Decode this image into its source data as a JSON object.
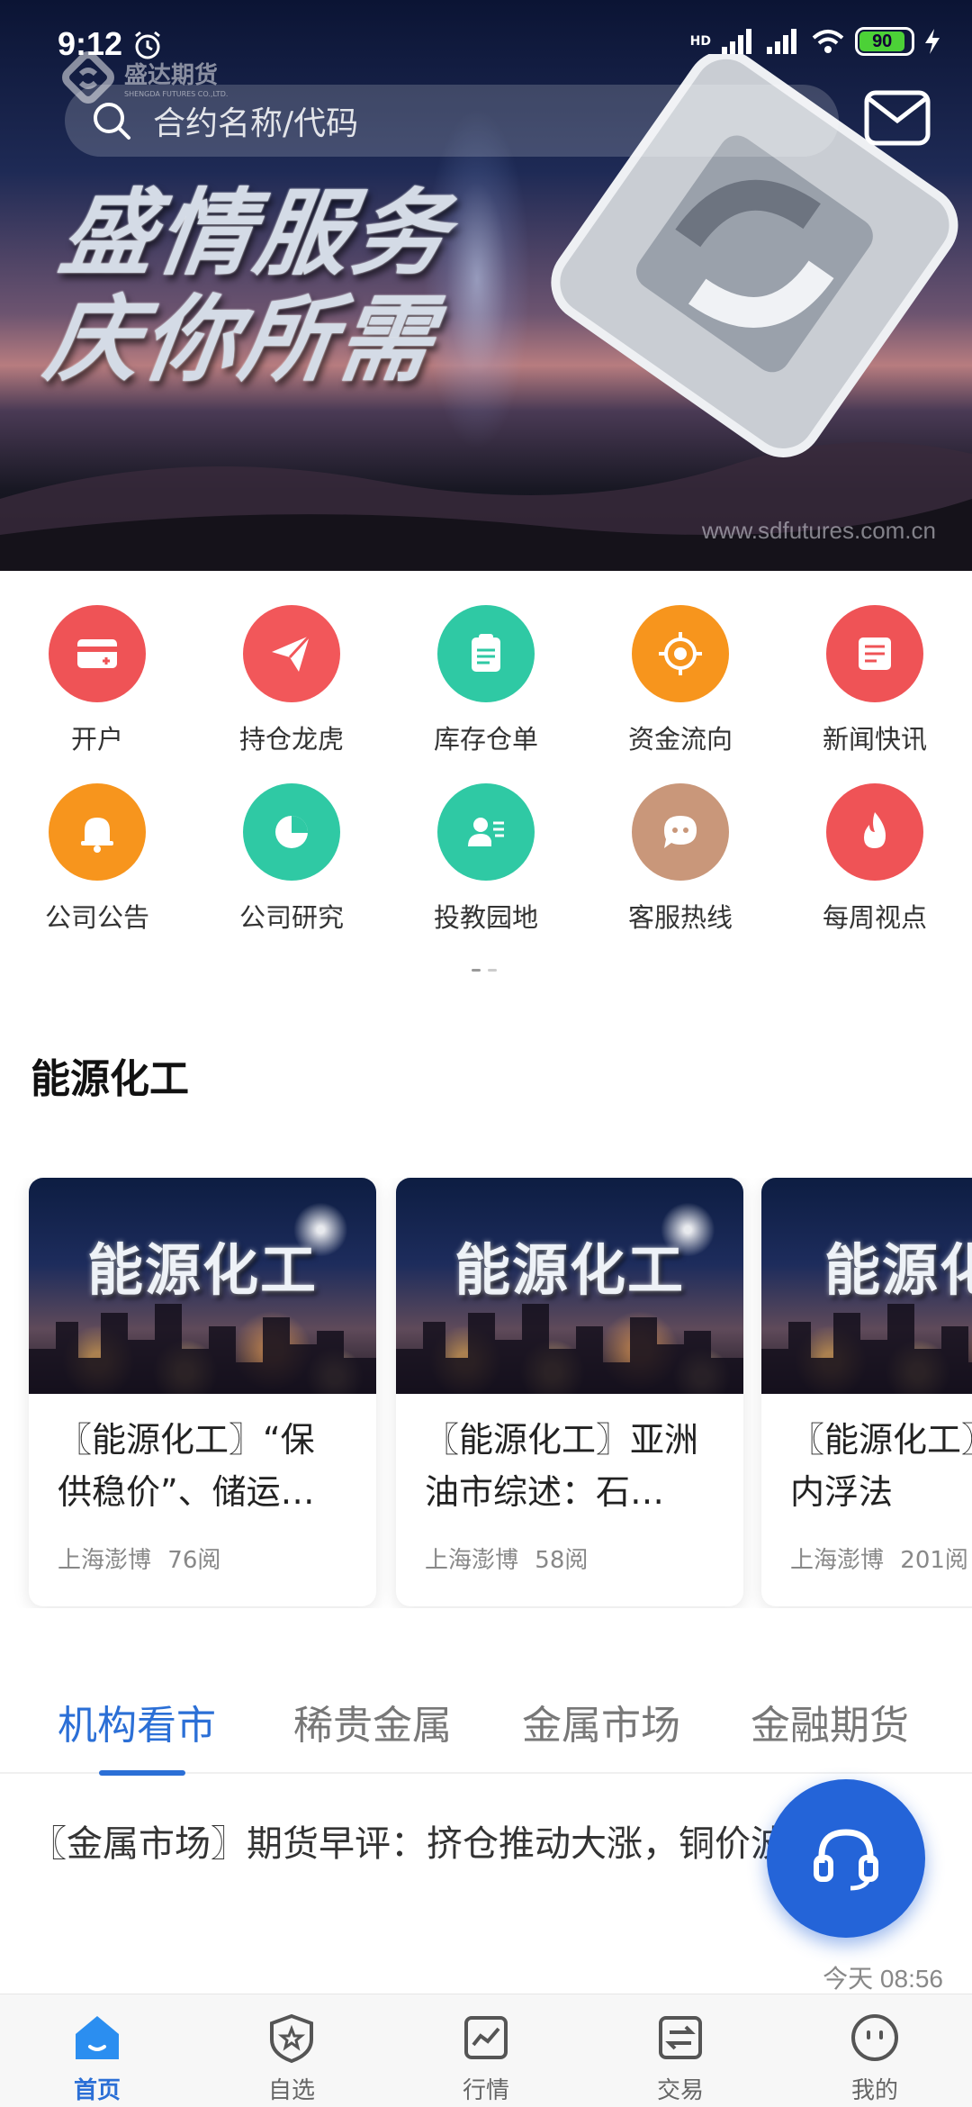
{
  "status_bar": {
    "time": "9:12",
    "battery": "90",
    "network": "HD"
  },
  "banner": {
    "slogan_line1": "盛情服务",
    "slogan_line2": "庆你所需",
    "url": "www.sdfutures.com.cn",
    "brand": "盛达期货",
    "brand_sub": "SHENGDA FUTURES CO.,LTD."
  },
  "search": {
    "placeholder": "合约名称/代码"
  },
  "quick_menu": [
    {
      "label": "开户",
      "icon": "card-icon",
      "color": "#ef5356"
    },
    {
      "label": "持仓龙虎",
      "icon": "paper-plane-icon",
      "color": "#f2575a"
    },
    {
      "label": "库存仓单",
      "icon": "clipboard-icon",
      "color": "#2fc9a4"
    },
    {
      "label": "资金流向",
      "icon": "target-icon",
      "color": "#f7951d"
    },
    {
      "label": "新闻快讯",
      "icon": "news-icon",
      "color": "#ef5356"
    },
    {
      "label": "公司公告",
      "icon": "bell-icon",
      "color": "#f7951d"
    },
    {
      "label": "公司研究",
      "icon": "pie-chart-icon",
      "color": "#2fc9a4"
    },
    {
      "label": "投教园地",
      "icon": "teacher-icon",
      "color": "#2fc9a4"
    },
    {
      "label": "客服热线",
      "icon": "chat-bubble-icon",
      "color": "#c9977a"
    },
    {
      "label": "每周视点",
      "icon": "flame-icon",
      "color": "#ef5356"
    }
  ],
  "section": {
    "title": "能源化工",
    "cards": [
      {
        "image_label": "能源化工",
        "title": "〖能源化工〗“保供稳价”、储运…",
        "source": "上海澎博",
        "reads": "76阅"
      },
      {
        "image_label": "能源化工",
        "title": "〖能源化工〗亚洲油市综述：石…",
        "source": "上海澎博",
        "reads": "58阅"
      },
      {
        "image_label": "能源化",
        "title": "〖能源化工〗末国内浮法",
        "source": "上海澎博",
        "reads": "201阅"
      }
    ]
  },
  "tabs": [
    "机构看市",
    "稀贵金属",
    "金属市场",
    "金融期货"
  ],
  "news": {
    "title": "〖金属市场〗期货早评：挤仓推动大涨，铜价波动加大",
    "time": "今天 08:56"
  },
  "nav": [
    "首页",
    "自选",
    "行情",
    "交易",
    "我的"
  ],
  "colors": {
    "accent": "#2b6fd6",
    "fab": "#2464d8"
  }
}
